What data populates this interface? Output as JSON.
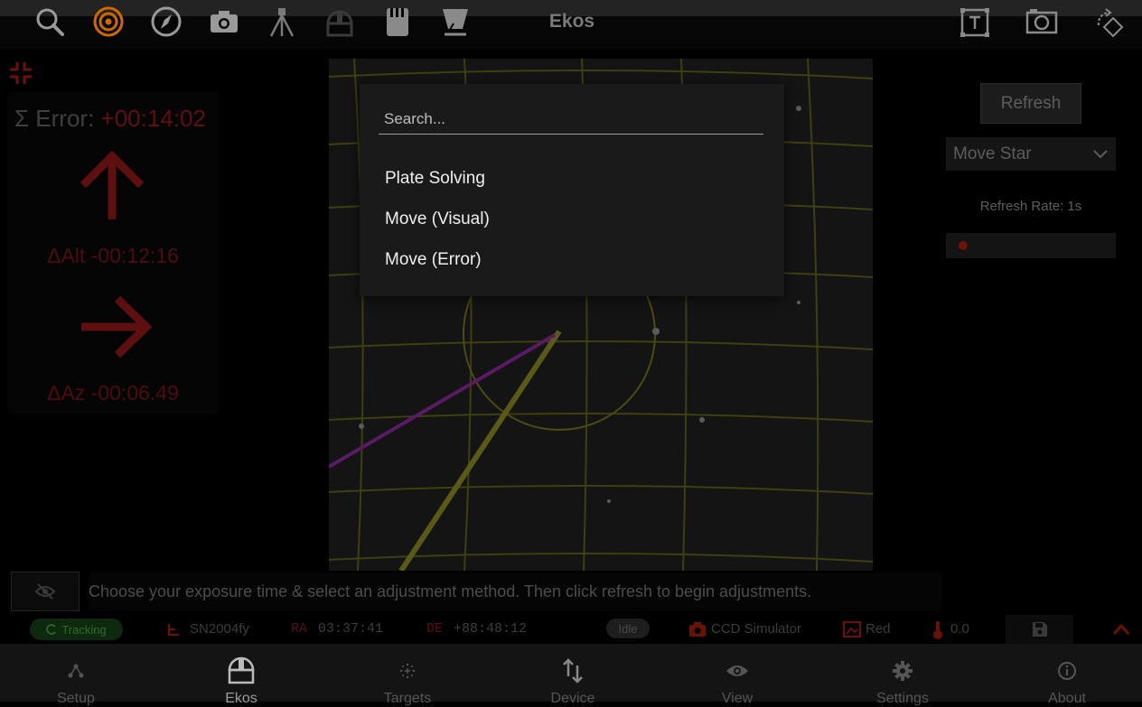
{
  "app": {
    "title": "Ekos"
  },
  "toolbar": {
    "left_tools": [
      "search-icon",
      "target-icon",
      "compass-icon",
      "camera-icon",
      "tripod-icon",
      "observatory-icon",
      "filter-wheel-icon",
      "flat-panel-icon"
    ],
    "right_tools": [
      "crop-frame-icon",
      "capture-frame-icon",
      "rotate-diamond-icon"
    ]
  },
  "error_panel": {
    "sigma_label": "Σ Error: ",
    "sigma_value": "+00:14:02",
    "alt_label": "ΔAlt -00:12:16",
    "az_label": "ΔAz -00:06.49"
  },
  "right_panel": {
    "refresh_label": "Refresh",
    "mode_selected": "Move Star",
    "refresh_rate_label": "Refresh Rate: 1s",
    "refresh_rate_value": 0.05
  },
  "menu": {
    "search_placeholder": "Search...",
    "items": [
      "Plate Solving",
      "Move (Visual)",
      "Move (Error)"
    ]
  },
  "hint": {
    "text": "Choose your exposure time & select an adjustment method. Then click refresh to begin adjustments."
  },
  "status": {
    "tracking": "Tracking",
    "target": "SN2004fy",
    "ra_label": "RA",
    "ra_value": "03:37:41",
    "de_label": "DE",
    "de_value": "+88:48:12",
    "state": "Idle",
    "camera": "CCD Simulator",
    "filter": "Red",
    "temperature": "0.0"
  },
  "nav": {
    "items": [
      {
        "label": "Setup",
        "icon": "setup-icon"
      },
      {
        "label": "Ekos",
        "icon": "observatory-dome-icon",
        "active": true
      },
      {
        "label": "Targets",
        "icon": "targets-icon"
      },
      {
        "label": "Device",
        "icon": "device-icon"
      },
      {
        "label": "View",
        "icon": "eye-icon"
      },
      {
        "label": "Settings",
        "icon": "gear-icon"
      },
      {
        "label": "About",
        "icon": "info-icon"
      }
    ]
  },
  "colors": {
    "accent_orange": "#d06a00",
    "error_red": "#5e0f0f",
    "grid_yellow": "#5a5a16",
    "pole_magenta": "#7a1a8a",
    "tracking_green": "#2f6b2f"
  }
}
